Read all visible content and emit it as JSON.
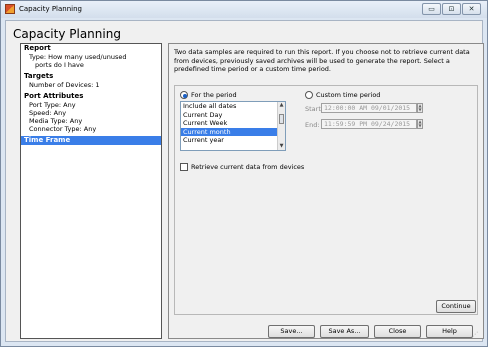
{
  "window": {
    "title": "Capacity Planning",
    "controls": {
      "minimize": "▭",
      "maximize": "⊡",
      "close": "✕"
    }
  },
  "header": {
    "title": "Capacity Planning"
  },
  "sidebar": {
    "report": {
      "heading": "Report",
      "type_line1": "Type: How many used/unused",
      "type_line2": "ports do I have"
    },
    "targets": {
      "heading": "Targets",
      "devices": "Number of Devices: 1"
    },
    "port_attributes": {
      "heading": "Port Attributes",
      "port_type": "Port Type: Any",
      "speed": "Speed: Any",
      "media_type": "Media Type: Any",
      "connector_type": "Connector Type: Any"
    },
    "time_frame": {
      "label": "Time Frame"
    }
  },
  "main": {
    "description": "Two data samples are required to run this report.  If you choose not to retrieve current data from devices, previously saved archives will be used to generate the report. Select a predefined time period or a custom time period.",
    "for_period_label": "For the period",
    "custom_period_label": "Custom time period",
    "periods": [
      "Include all dates",
      "Current Day",
      "Current Week",
      "Current month",
      "Current year"
    ],
    "selected_period": "Current month",
    "start_label": "Start:",
    "start_value": "12:00:00 AM 09/01/2015",
    "end_label": "End:",
    "end_value": "11:59:59 PM 09/24/2015",
    "retrieve_label": "Retrieve current data from devices",
    "continue_label": "Continue"
  },
  "footer": {
    "save": "Save...",
    "save_as": "Save As...",
    "close": "Close",
    "help": "Help"
  },
  "colors": {
    "selection": "#3a7ee8",
    "accent_radio": "#1a5fc4"
  }
}
